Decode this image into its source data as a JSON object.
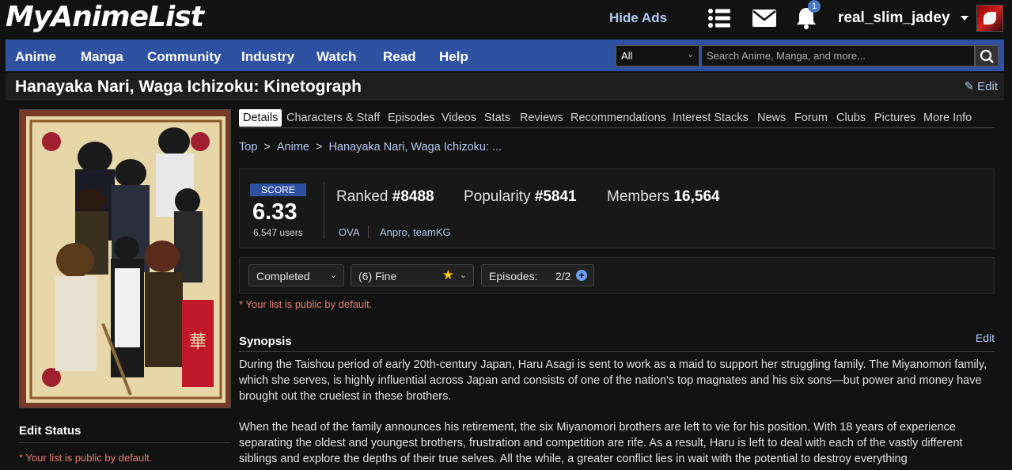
{
  "header": {
    "logo": "MyAnimeList",
    "hide_ads": "Hide Ads",
    "notification_count": "1",
    "username": "real_slim_jadey"
  },
  "nav": {
    "items": [
      "Anime",
      "Manga",
      "Community",
      "Industry",
      "Watch",
      "Read",
      "Help"
    ],
    "search_category": "All",
    "search_placeholder": "Search Anime, Manga, and more..."
  },
  "title": {
    "text": "Hanayaka Nari, Waga Ichizoku: Kinetograph",
    "edit": "Edit"
  },
  "left": {
    "edit_status_heading": "Edit Status",
    "public_note": "* Your list is public by default."
  },
  "tabs": [
    "Details",
    "Characters & Staff",
    "Episodes",
    "Videos",
    "Stats",
    "Reviews",
    "Recommendations",
    "Interest Stacks",
    "News",
    "Forum",
    "Clubs",
    "Pictures",
    "More Info"
  ],
  "breadcrumb": {
    "top": "Top",
    "sep": ">",
    "anime": "Anime",
    "current": "Hanayaka Nari, Waga Ichizoku: ..."
  },
  "score": {
    "label": "SCORE",
    "value": "6.33",
    "users": "6,547 users",
    "ranked_label": "Ranked",
    "ranked_value": "#8488",
    "popularity_label": "Popularity",
    "popularity_value": "#5841",
    "members_label": "Members",
    "members_value": "16,564",
    "type": "OVA",
    "studio_1": "Anpro",
    "studio_sep": ",",
    "studio_2": "teamKG"
  },
  "status": {
    "watch_status": "Completed",
    "rating": "(6) Fine",
    "episodes_label": "Episodes:",
    "episodes_value": "2/2",
    "public_note": "* Your list is public by default."
  },
  "synopsis": {
    "title": "Synopsis",
    "edit": "Edit",
    "para_1": "During the Taishou period of early 20th-century Japan, Haru Asagi is sent to work as a maid to support her struggling family. The Miyanomori family, which she serves, is highly influential across Japan and consists of one of the nation's top magnates and his six sons—but power and money have brought out the cruelest in these brothers.",
    "para_2": "When the head of the family announces his retirement, the six Miyanomori brothers are left to vie for his position. With 18 years of experience separating the oldest and youngest brothers, frustration and competition are rife. As a result, Haru is left to deal with each of the vastly different siblings and explore the depths of their true selves. All the while, a greater conflict lies in wait with the potential to destroy everything"
  },
  "colors": {
    "nav_blue": "#2e51a2",
    "link": "#b4c8f0",
    "warning": "#e77f75",
    "background": "#121212"
  }
}
